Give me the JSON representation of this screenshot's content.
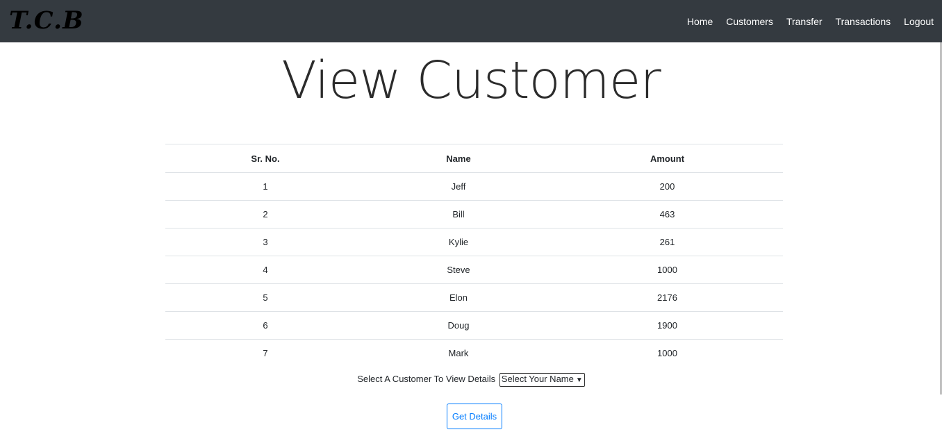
{
  "navbar": {
    "brand": "T.C.B",
    "links": [
      "Home",
      "Customers",
      "Transfer",
      "Transactions",
      "Logout"
    ]
  },
  "page": {
    "title": "View Customer"
  },
  "table": {
    "headers": [
      "Sr. No.",
      "Name",
      "Amount"
    ],
    "rows": [
      [
        "1",
        "Jeff",
        "200"
      ],
      [
        "2",
        "Bill",
        "463"
      ],
      [
        "3",
        "Kylie",
        "261"
      ],
      [
        "4",
        "Steve",
        "1000"
      ],
      [
        "5",
        "Elon",
        "2176"
      ],
      [
        "6",
        "Doug",
        "1900"
      ],
      [
        "7",
        "Mark",
        "1000"
      ]
    ]
  },
  "select": {
    "label": "Select A Customer To View Details",
    "selected": "Select Your Name"
  },
  "button": {
    "label": "Get Details",
    "color": "#007bff"
  },
  "colors": {
    "navbar_bg": "#343a40"
  }
}
